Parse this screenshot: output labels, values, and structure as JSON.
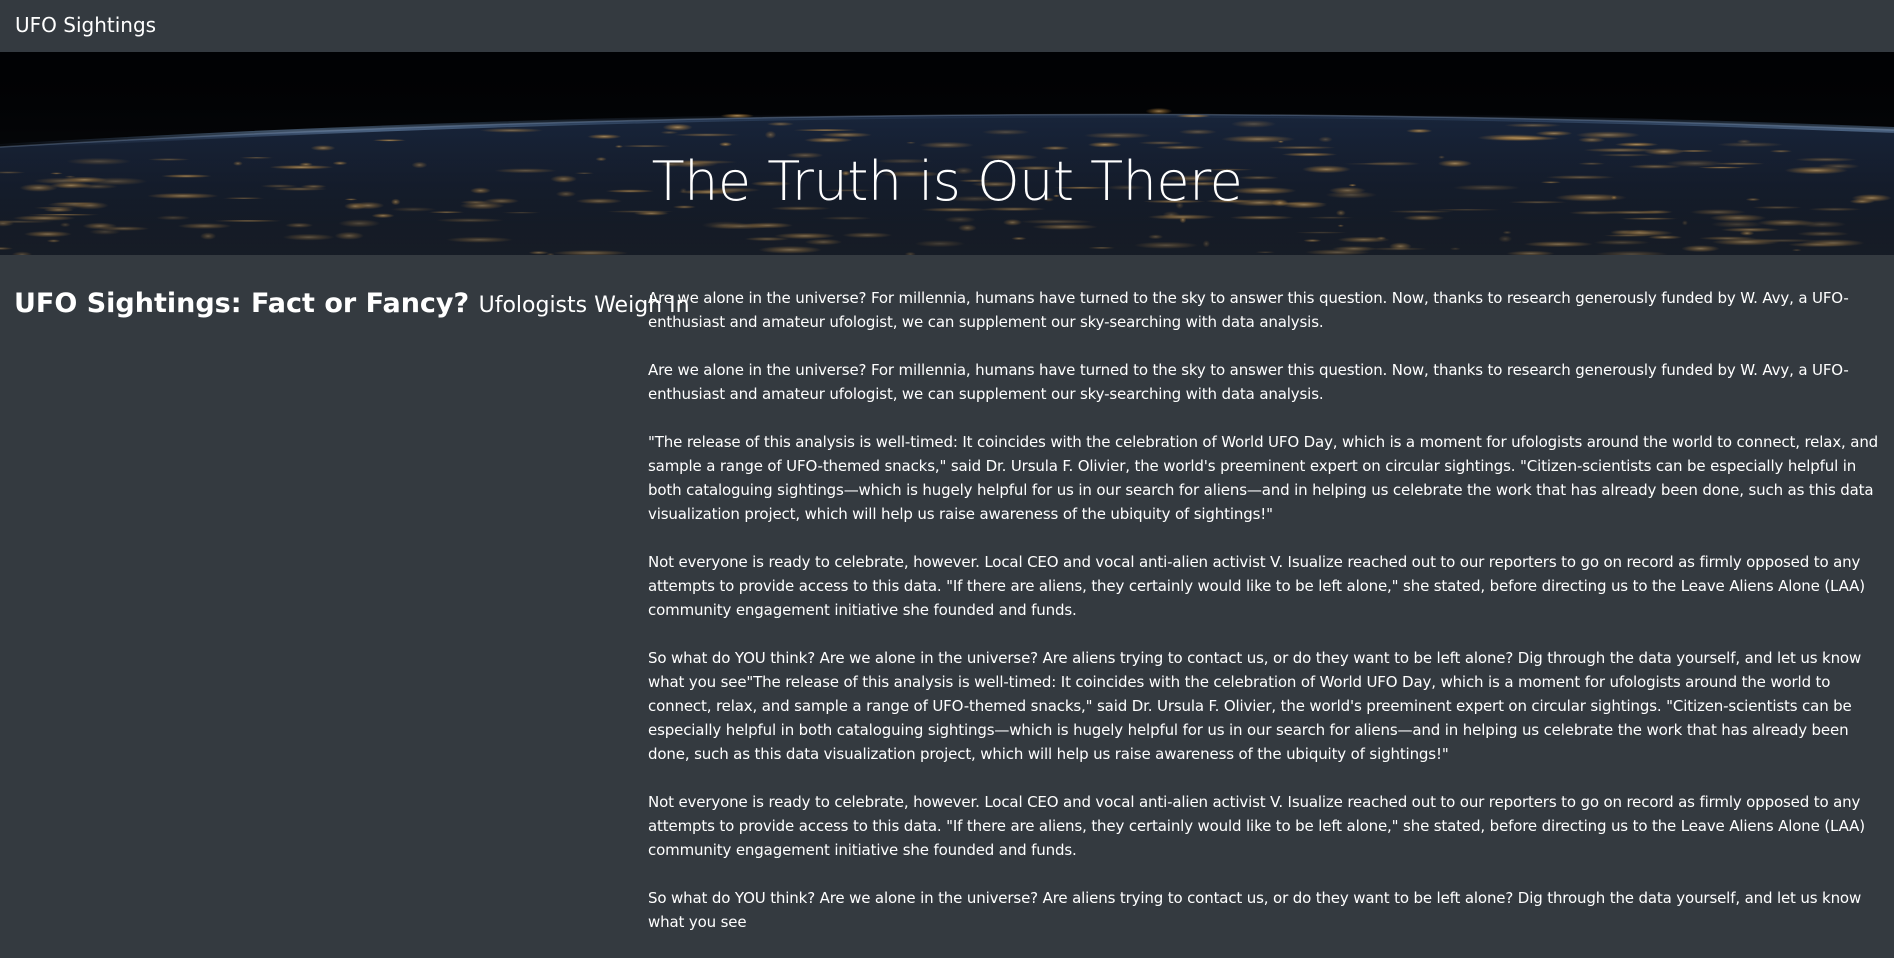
{
  "navbar": {
    "brand": "UFO Sightings"
  },
  "hero": {
    "title": "The Truth is Out There"
  },
  "article": {
    "heading": "UFO Sightings: Fact or Fancy?",
    "subheading": "Ufologists Weigh In",
    "paragraphs": [
      "Are we alone in the universe? For millennia, humans have turned to the sky to answer this question. Now, thanks to research generously funded by W. Avy, a UFO-enthusiast and amateur ufologist, we can supplement our sky-searching with data analysis.",
      "Are we alone in the universe? For millennia, humans have turned to the sky to answer this question. Now, thanks to research generously funded by W. Avy, a UFO-enthusiast and amateur ufologist, we can supplement our sky-searching with data analysis.",
      "\"The release of this analysis is well-timed: It coincides with the celebration of World UFO Day, which is a moment for ufologists around the world to connect, relax, and sample a range of UFO-themed snacks,\" said Dr. Ursula F. Olivier, the world's preeminent expert on circular sightings. \"Citizen-scientists can be especially helpful in both cataloguing sightings—which is hugely helpful for us in our search for aliens—and in helping us celebrate the work that has already been done, such as this data visualization project, which will help us raise awareness of the ubiquity of sightings!\"",
      "Not everyone is ready to celebrate, however. Local CEO and vocal anti-alien activist V. Isualize reached out to our reporters to go on record as firmly opposed to any attempts to provide access to this data. \"If there are aliens, they certainly would like to be left alone,\" she stated, before directing us to the Leave Aliens Alone (LAA) community engagement initiative she founded and funds.",
      "So what do YOU think? Are we alone in the universe? Are aliens trying to contact us, or do they want to be left alone? Dig through the data yourself, and let us know what you see\"The release of this analysis is well-timed: It coincides with the celebration of World UFO Day, which is a moment for ufologists around the world to connect, relax, and sample a range of UFO-themed snacks,\" said Dr. Ursula F. Olivier, the world's preeminent expert on circular sightings. \"Citizen-scientists can be especially helpful in both cataloguing sightings—which is hugely helpful for us in our search for aliens—and in helping us celebrate the work that has already been done, such as this data visualization project, which will help us raise awareness of the ubiquity of sightings!\"",
      "Not everyone is ready to celebrate, however. Local CEO and vocal anti-alien activist V. Isualize reached out to our reporters to go on record as firmly opposed to any attempts to provide access to this data. \"If there are aliens, they certainly would like to be left alone,\" she stated, before directing us to the Leave Aliens Alone (LAA) community engagement initiative she founded and funds.",
      "So what do YOU think? Are we alone in the universe? Are aliens trying to contact us, or do they want to be left alone? Dig through the data yourself, and let us know what you see"
    ]
  },
  "colors": {
    "background": "#343a40",
    "text": "#ffffff",
    "hero_dark": "#020305"
  }
}
